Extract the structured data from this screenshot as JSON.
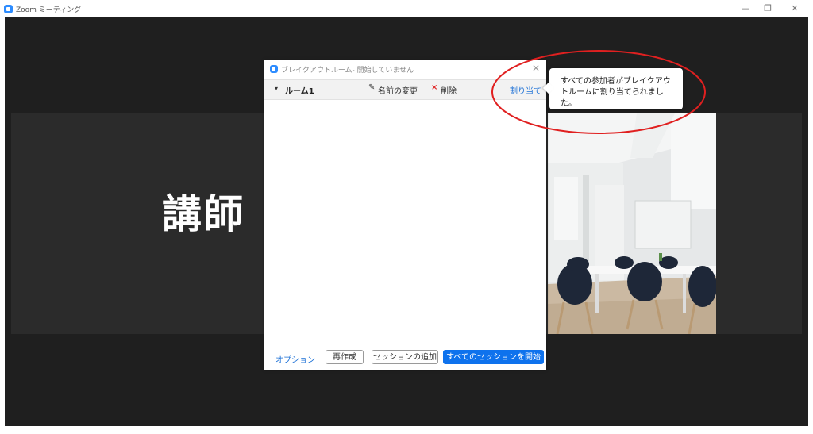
{
  "window": {
    "app_title": "Zoom ミーティング",
    "minimize_glyph": "—",
    "restore_glyph": "❐",
    "close_glyph": "✕"
  },
  "meeting": {
    "speaker_name": "講師"
  },
  "dialog": {
    "title": "ブレイクアウトルーム- 開始していません",
    "close_glyph": "✕",
    "room": {
      "arrow_glyph": "▾",
      "name": "ルーム1",
      "rename_icon_glyph": "✎",
      "rename_label": "名前の変更",
      "delete_icon_glyph": "×",
      "delete_label": "削除",
      "assign_label": "割り当て"
    },
    "footer": {
      "options_label": "オプション",
      "recreate_label": "再作成",
      "add_session_label": "セッションの追加",
      "start_all_label": "すべてのセッションを開始"
    }
  },
  "tooltip": {
    "text": "すべての参加者がブレイクアウトルームに割り当てられました。"
  },
  "colors": {
    "accent": "#0e72ed",
    "link": "#1a6fd6",
    "annotation": "#e02020",
    "meeting_bg": "#1f1f1f"
  }
}
